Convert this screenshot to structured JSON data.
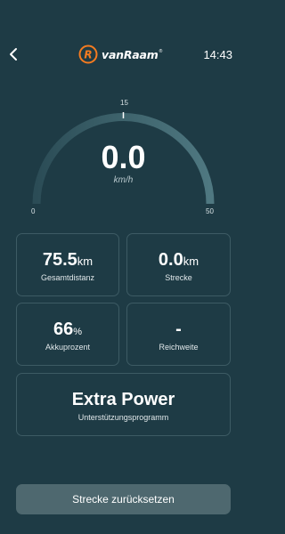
{
  "header": {
    "brand": "vanRaam",
    "brand_mark": "R",
    "brand_reg": "®",
    "time": "14:43"
  },
  "icons": {
    "back": "chevron-left-icon",
    "logo": "vanraam-logo-icon"
  },
  "speedometer": {
    "value": "0.0",
    "unit": "km/h",
    "min_label": "0",
    "mid_label": "15",
    "max_label": "50",
    "current_fraction": 0
  },
  "stats": {
    "total_distance": {
      "value": "75.5",
      "unit": "km",
      "label": "Gesamtdistanz"
    },
    "trip": {
      "value": "0.0",
      "unit": "km",
      "label": "Strecke"
    },
    "battery": {
      "value": "66",
      "unit": "%",
      "label": "Akkuprozent"
    },
    "range": {
      "value": "-",
      "label": "Reichweite"
    },
    "support_program": {
      "value": "Extra Power",
      "label": "Unterstützungsprogramm"
    }
  },
  "actions": {
    "reset_trip_label": "Strecke zurücksetzen"
  },
  "colors": {
    "background": "#1e3b45",
    "card_border": "#3d5b64",
    "gauge_track_dark": "#2b4c56",
    "gauge_track_light": "#4f7881",
    "brand_orange": "#f47b20",
    "button_bg": "#4e686f"
  }
}
